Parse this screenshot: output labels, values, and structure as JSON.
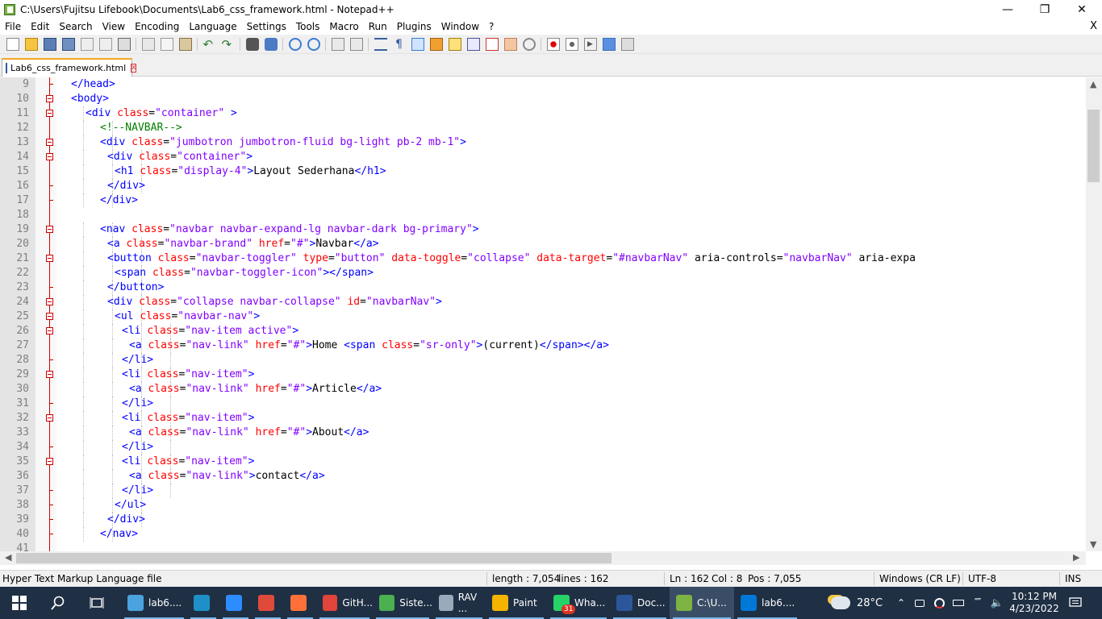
{
  "window": {
    "title": "C:\\Users\\Fujitsu Lifebook\\Documents\\Lab6_css_framework.html - Notepad++"
  },
  "menu": [
    "File",
    "Edit",
    "Search",
    "View",
    "Encoding",
    "Language",
    "Settings",
    "Tools",
    "Macro",
    "Run",
    "Plugins",
    "Window",
    "?"
  ],
  "menu_close": "X",
  "tab": {
    "label": "Lab6_css_framework.html",
    "close": "x"
  },
  "editor": {
    "lines": [
      {
        "n": "9",
        "fold": "end",
        "indent": 2,
        "html": "<span class='t'>&lt;/head&gt;</span>"
      },
      {
        "n": "10",
        "fold": "box",
        "indent": 2,
        "html": "<span class='t'>&lt;body&gt;</span>"
      },
      {
        "n": "11",
        "fold": "box",
        "indent": 4,
        "html": "<span class='t'>&lt;div</span> <span class='a'>class</span><span class='x'>=</span><span class='v'>\"container\"</span> <span class='t'>&gt;</span>"
      },
      {
        "n": "12",
        "fold": "line",
        "indent": 6,
        "html": "<span class='c'>&lt;!--NAVBAR--&gt;</span>"
      },
      {
        "n": "13",
        "fold": "box",
        "indent": 6,
        "html": "<span class='t'>&lt;div</span> <span class='a'>class</span><span class='x'>=</span><span class='v'>\"jumbotron jumbotron-fluid bg-light pb-2 mb-1\"</span><span class='t'>&gt;</span>"
      },
      {
        "n": "14",
        "fold": "box",
        "indent": 7,
        "html": "<span class='t'>&lt;div</span> <span class='a'>class</span><span class='x'>=</span><span class='v'>\"container\"</span><span class='t'>&gt;</span>"
      },
      {
        "n": "15",
        "fold": "line",
        "indent": 8,
        "html": "<span class='t'>&lt;h1</span> <span class='a'>class</span><span class='x'>=</span><span class='v'>\"display-4\"</span><span class='t'>&gt;</span><span class='x'>Layout Sederhana</span><span class='t'>&lt;/h1&gt;</span>"
      },
      {
        "n": "16",
        "fold": "end",
        "indent": 7,
        "html": "<span class='t'>&lt;/div&gt;</span>"
      },
      {
        "n": "17",
        "fold": "end",
        "indent": 6,
        "html": "<span class='t'>&lt;/div&gt;</span>"
      },
      {
        "n": "18",
        "fold": "line",
        "indent": 0,
        "html": ""
      },
      {
        "n": "19",
        "fold": "box",
        "indent": 6,
        "html": "<span class='t'>&lt;nav</span> <span class='a'>class</span><span class='x'>=</span><span class='v'>\"navbar navbar-expand-lg navbar-dark bg-primary\"</span><span class='t'>&gt;</span>"
      },
      {
        "n": "20",
        "fold": "line",
        "indent": 7,
        "html": "<span class='t'>&lt;a</span> <span class='a'>class</span><span class='x'>=</span><span class='v'>\"navbar-brand\"</span> <span class='a'>href</span><span class='x'>=</span><span class='v'>\"#\"</span><span class='t'>&gt;</span><span class='x'>Navbar</span><span class='t'>&lt;/a&gt;</span>"
      },
      {
        "n": "21",
        "fold": "box",
        "indent": 7,
        "html": "<span class='t'>&lt;button</span> <span class='a'>class</span><span class='x'>=</span><span class='v'>\"navbar-toggler\"</span> <span class='a'>type</span><span class='x'>=</span><span class='v'>\"button\"</span> <span class='a'>data-toggle</span><span class='x'>=</span><span class='v'>\"collapse\"</span> <span class='a'>data-target</span><span class='x'>=</span><span class='v'>\"#navbarNav\"</span> <span class='x'>aria-controls=</span><span class='v'>\"navbarNav\"</span> <span class='x'>aria-expa</span>"
      },
      {
        "n": "22",
        "fold": "line",
        "indent": 8,
        "html": "<span class='t'>&lt;span</span> <span class='a'>class</span><span class='x'>=</span><span class='v'>\"navbar-toggler-icon\"</span><span class='t'>&gt;&lt;/span&gt;</span>"
      },
      {
        "n": "23",
        "fold": "end",
        "indent": 7,
        "html": "<span class='t'>&lt;/button&gt;</span>"
      },
      {
        "n": "24",
        "fold": "box",
        "indent": 7,
        "html": "<span class='t'>&lt;div</span> <span class='a'>class</span><span class='x'>=</span><span class='v'>\"collapse navbar-collapse\"</span> <span class='a'>id</span><span class='x'>=</span><span class='v'>\"navbarNav\"</span><span class='t'>&gt;</span>"
      },
      {
        "n": "25",
        "fold": "box",
        "indent": 8,
        "html": "<span class='t'>&lt;ul</span> <span class='a'>class</span><span class='x'>=</span><span class='v'>\"navbar-nav\"</span><span class='t'>&gt;</span>"
      },
      {
        "n": "26",
        "fold": "box",
        "indent": 9,
        "html": "<span class='t'>&lt;li</span> <span class='a'>class</span><span class='x'>=</span><span class='v'>\"nav-item active\"</span><span class='t'>&gt;</span>"
      },
      {
        "n": "27",
        "fold": "line",
        "indent": 10,
        "html": "<span class='t'>&lt;a</span> <span class='a'>class</span><span class='x'>=</span><span class='v'>\"nav-link\"</span> <span class='a'>href</span><span class='x'>=</span><span class='v'>\"#\"</span><span class='t'>&gt;</span><span class='x'>Home </span><span class='t'>&lt;span</span> <span class='a'>class</span><span class='x'>=</span><span class='v'>\"sr-only\"</span><span class='t'>&gt;</span><span class='x'>(current)</span><span class='t'>&lt;/span&gt;&lt;/a&gt;</span>"
      },
      {
        "n": "28",
        "fold": "end",
        "indent": 9,
        "html": "<span class='t'>&lt;/li&gt;</span>"
      },
      {
        "n": "29",
        "fold": "box",
        "indent": 9,
        "html": "<span class='t'>&lt;li</span> <span class='a'>class</span><span class='x'>=</span><span class='v'>\"nav-item\"</span><span class='t'>&gt;</span>"
      },
      {
        "n": "30",
        "fold": "line",
        "indent": 10,
        "html": "<span class='t'>&lt;a</span> <span class='a'>class</span><span class='x'>=</span><span class='v'>\"nav-link\"</span> <span class='a'>href</span><span class='x'>=</span><span class='v'>\"#\"</span><span class='t'>&gt;</span><span class='x'>Article</span><span class='t'>&lt;/a&gt;</span>"
      },
      {
        "n": "31",
        "fold": "end",
        "indent": 9,
        "html": "<span class='t'>&lt;/li&gt;</span>"
      },
      {
        "n": "32",
        "fold": "box",
        "indent": 9,
        "html": "<span class='t'>&lt;li</span> <span class='a'>class</span><span class='x'>=</span><span class='v'>\"nav-item\"</span><span class='t'>&gt;</span>"
      },
      {
        "n": "33",
        "fold": "line",
        "indent": 10,
        "html": "<span class='t'>&lt;a</span> <span class='a'>class</span><span class='x'>=</span><span class='v'>\"nav-link\"</span> <span class='a'>href</span><span class='x'>=</span><span class='v'>\"#\"</span><span class='t'>&gt;</span><span class='x'>About</span><span class='t'>&lt;/a&gt;</span>"
      },
      {
        "n": "34",
        "fold": "end",
        "indent": 9,
        "html": "<span class='t'>&lt;/li&gt;</span>"
      },
      {
        "n": "35",
        "fold": "box",
        "indent": 9,
        "html": "<span class='t'>&lt;li</span> <span class='a'>class</span><span class='x'>=</span><span class='v'>\"nav-item\"</span><span class='t'>&gt;</span>"
      },
      {
        "n": "36",
        "fold": "line",
        "indent": 10,
        "html": "<span class='t'>&lt;a</span> <span class='a'>class</span><span class='x'>=</span><span class='v'>\"nav-link\"</span><span class='t'>&gt;</span><span class='x'>contact</span><span class='t'>&lt;/a&gt;</span>"
      },
      {
        "n": "37",
        "fold": "end",
        "indent": 9,
        "html": "<span class='t'>&lt;/li&gt;</span>"
      },
      {
        "n": "38",
        "fold": "end",
        "indent": 8,
        "html": "<span class='t'>&lt;/ul&gt;</span>"
      },
      {
        "n": "39",
        "fold": "end",
        "indent": 7,
        "html": "<span class='t'>&lt;/div&gt;</span>"
      },
      {
        "n": "40",
        "fold": "end",
        "indent": 6,
        "html": "<span class='t'>&lt;/nav&gt;</span>"
      },
      {
        "n": "41",
        "fold": "line",
        "indent": 0,
        "html": ""
      }
    ]
  },
  "status": {
    "filetype": "Hyper Text Markup Language file",
    "length": "length : 7,054",
    "lines": "lines : 162",
    "ln": "Ln : 162",
    "col": "Col : 8",
    "pos": "Pos : 7,055",
    "eol": "Windows (CR LF)",
    "encoding": "UTF-8",
    "mode": "INS"
  },
  "taskbar": {
    "items": [
      {
        "label": "lab6....",
        "icon": "file-icon",
        "color": "#4aa3df"
      },
      {
        "label": "",
        "icon": "edge-icon",
        "color": "#1e90c8"
      },
      {
        "label": "",
        "icon": "zoom-icon",
        "color": "#2d8cff"
      },
      {
        "label": "",
        "icon": "chrome-icon",
        "color": "#e04a3a"
      },
      {
        "label": "",
        "icon": "firefox-icon",
        "color": "#ff7139"
      },
      {
        "label": "GitH...",
        "icon": "github-desktop-icon",
        "color": "#e0443a"
      },
      {
        "label": "Siste...",
        "icon": "chrome-profile-icon",
        "color": "#4caf50"
      },
      {
        "label": "RAV ...",
        "icon": "rav-icon",
        "color": "#9ab"
      },
      {
        "label": "Paint",
        "icon": "paint-icon",
        "color": "#f4b400"
      },
      {
        "label": "Wha...",
        "icon": "whatsapp-icon",
        "color": "#25d366",
        "badge": "31"
      },
      {
        "label": "Doc...",
        "icon": "word-icon",
        "color": "#2b579a"
      },
      {
        "label": "C:\\U...",
        "icon": "notepadpp-icon",
        "color": "#7cb342"
      },
      {
        "label": "lab6....",
        "icon": "photos-icon",
        "color": "#0078d7"
      }
    ],
    "weather": "28°C",
    "time": "10:12 PM",
    "date": "4/23/2022"
  }
}
